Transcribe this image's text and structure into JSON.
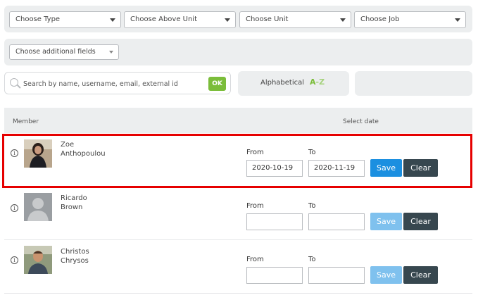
{
  "filters": {
    "type_select": "Choose Type",
    "above_unit_select": "Choose Above Unit",
    "unit_select": "Choose Unit",
    "job_select": "Choose Job",
    "additional_fields_select": "Choose additional fields"
  },
  "search": {
    "placeholder": "Search by name, username, email, external id",
    "ok_label": "OK"
  },
  "sort": {
    "label": "Alphabetical",
    "az_a": "A",
    "az_dash": "-",
    "az_z": "Z"
  },
  "table": {
    "header_member": "Member",
    "header_select_date": "Select date",
    "from_label": "From",
    "to_label": "To",
    "save_label": "Save",
    "clear_label": "Clear",
    "rows": [
      {
        "first_name": "Zoe",
        "last_name": "Anthopoulou",
        "from": "2020-10-19",
        "to": "2020-11-19",
        "save_enabled": true,
        "selected": true
      },
      {
        "first_name": "Ricardo",
        "last_name": "Brown",
        "from": "",
        "to": "",
        "save_enabled": false,
        "selected": false
      },
      {
        "first_name": "Christos",
        "last_name": "Chrysos",
        "from": "",
        "to": "",
        "save_enabled": false,
        "selected": false
      }
    ]
  },
  "colors": {
    "accent_green": "#7bbd3a",
    "save_blue": "#1b8fe0",
    "save_blue_disabled": "#7fc1ee",
    "clear_dark": "#37474f",
    "highlight_red": "#e60000",
    "panel_gray": "#eceeef"
  },
  "icons": {
    "search": "search-icon",
    "info": "info-icon",
    "caret": "chevron-down-icon"
  }
}
